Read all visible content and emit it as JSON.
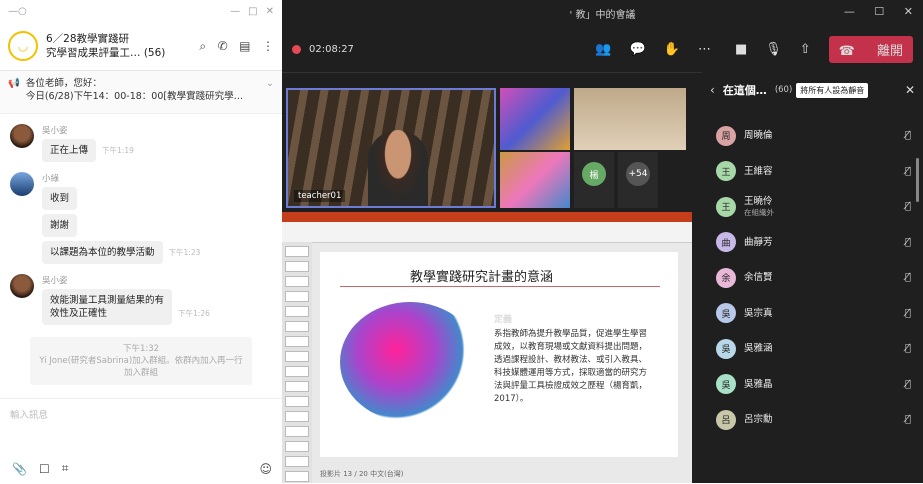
{
  "chat": {
    "window_controls": [
      "—",
      "□",
      "✕"
    ],
    "group_title_line1": "6／28教學實踐研",
    "group_title_line2": "究學習成果評量工… (56)",
    "pinned_line1": "各位老師，您好：",
    "pinned_line2": "今日(6/28)下午14：00-18：00[教學實踐研究學…",
    "messages": [
      {
        "sender": "吳小姿",
        "texts": [
          "正在上傳"
        ],
        "time": "下午1:19",
        "avatar": "woman"
      },
      {
        "sender": "小綠",
        "texts": [
          "收到",
          "謝謝"
        ],
        "time": "",
        "avatar": "landscape"
      },
      {
        "sender": "",
        "texts": [
          "以課題為本位的教學活動"
        ],
        "time": "下午1:23",
        "avatar": "none"
      },
      {
        "sender": "吳小姿",
        "texts": [
          "效能測量工具測量結果的有",
          "效性及正確性"
        ],
        "time": "下午1:26",
        "avatar": "woman"
      }
    ],
    "system_time": "下午1:32",
    "system_text": "Yi Jone(研究者Sabrina)加入群組。依群內加入再一行",
    "system_text2": "加入群組",
    "input_placeholder": "輸入訊息",
    "tools": [
      "📎",
      "☐",
      "⌗",
      "☺"
    ]
  },
  "meeting": {
    "window_title": "'  教」中的會議",
    "window_controls": [
      "—",
      "☐",
      "✕"
    ],
    "timer": "02:08:27",
    "leave_label": "離開",
    "main_speaker_label": "teacher01",
    "tile_labels": [
      "楊",
      "+54"
    ]
  },
  "slide": {
    "title": "教學實踐研究計畫的意涵",
    "subtitle": "定義",
    "body": "系指教師為提升教學品質，促進學生學習成效，以教育現場或文獻資料提出問題，透過課程設計、教材教法、或引入教具、科技媒體運用等方式，採取適當的研究方法與評量工具檢證成效之歷程（楊育凱，2017）。",
    "status": "投影片 13 / 20  中文(台灣)"
  },
  "participants": {
    "header_title": "在這個…",
    "count": "(60)",
    "mute_all": "將所有人設為靜音",
    "items": [
      {
        "name": "周曉倫",
        "sub": "",
        "color": "#d9a3a3",
        "initial": "周"
      },
      {
        "name": "王維容",
        "sub": "",
        "color": "#a8d8a8",
        "initial": "王"
      },
      {
        "name": "王曉伶",
        "sub": "在組織外",
        "color": "#a8d8a8",
        "initial": "王"
      },
      {
        "name": "曲靜芳",
        "sub": "",
        "color": "#c8b8e8",
        "initial": "曲"
      },
      {
        "name": "余信賢",
        "sub": "",
        "color": "#e8b8d8",
        "initial": "余"
      },
      {
        "name": "吳宗真",
        "sub": "",
        "color": "#b8c8e8",
        "initial": "吳"
      },
      {
        "name": "吳雅涵",
        "sub": "",
        "color": "#b8d8e8",
        "initial": "吳"
      },
      {
        "name": "吳雅晶",
        "sub": "",
        "color": "#a8e0c8",
        "initial": "吳"
      },
      {
        "name": "呂宗勳",
        "sub": "",
        "color": "#c8c8a8",
        "initial": "呂"
      }
    ]
  }
}
